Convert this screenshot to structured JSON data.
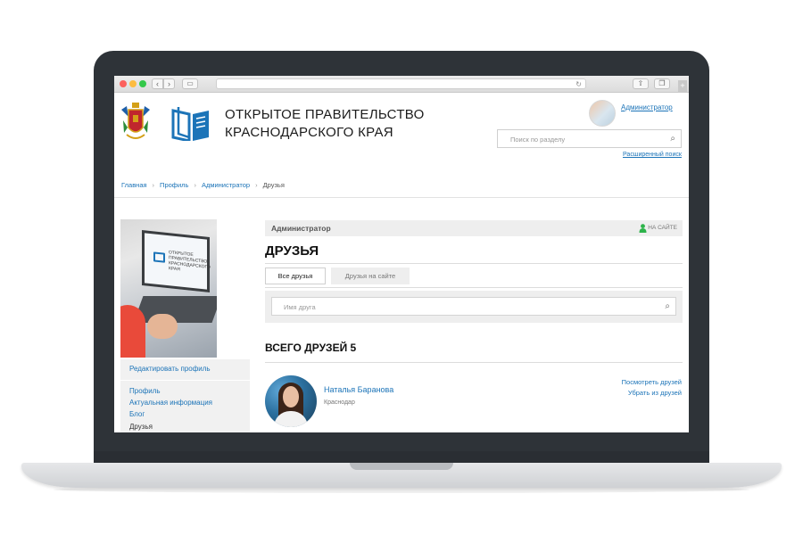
{
  "site": {
    "title_line1": "ОТКРЫТОЕ ПРАВИТЕЛЬСТВО",
    "title_line2": "КРАСНОДАРСКОГО КРАЯ"
  },
  "header": {
    "admin_link": "Администратор",
    "search_placeholder": "Поиск по разделу",
    "advanced_search": "Расширенный поиск"
  },
  "breadcrumb": [
    "Главная",
    "Профиль",
    "Администратор",
    "Друзья"
  ],
  "sidebar": {
    "promo_text_line1": "ОТКРЫТОЕ",
    "promo_text_line2": "ПРАВИТЕЛЬСТВО",
    "promo_text_line3": "КРАСНОДАРСКОГО КРАЯ",
    "edit_profile": "Редактировать профиль",
    "items": [
      "Профиль",
      "Актуальная информация",
      "Блог",
      "Друзья"
    ]
  },
  "main": {
    "user_name": "Администратор",
    "online_status": "НА САЙТЕ",
    "page_title": "ДРУЗЬЯ",
    "tabs": [
      "Все друзья",
      "Друзья на сайте"
    ],
    "friend_search_placeholder": "Имя друга",
    "total": "ВСЕГО ДРУЗЕЙ 5",
    "friends": [
      {
        "name": "Наталья Баранова",
        "city": "Краснодар",
        "action_view": "Посмотреть друзей",
        "action_remove": "Убрать из друзей"
      }
    ]
  },
  "colors": {
    "link": "#1c74b8",
    "online": "#2db34a",
    "laptop": "#2e3338"
  },
  "icons": {
    "emblem": "krasnodar-coat-of-arms-icon",
    "logo": "open-book-logo-icon",
    "search": "search-icon",
    "online": "user-online-icon"
  }
}
